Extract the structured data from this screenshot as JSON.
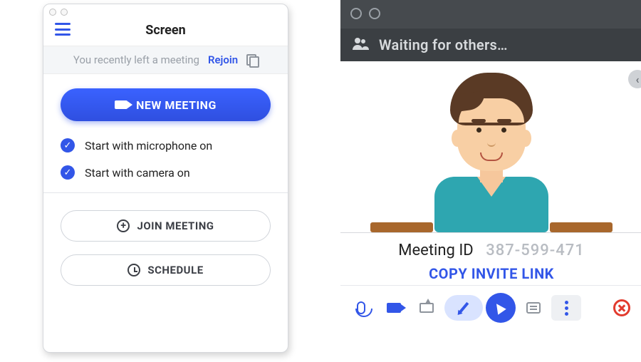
{
  "left": {
    "title": "Screen",
    "banner_text": "You recently left a meeting",
    "rejoin_label": "Rejoin",
    "new_meeting_label": "NEW MEETING",
    "opt_mic_label": "Start with microphone on",
    "opt_mic_checked": true,
    "opt_cam_label": "Start with camera on",
    "opt_cam_checked": true,
    "join_label": "JOIN MEETING",
    "schedule_label": "SCHEDULE"
  },
  "right": {
    "status_text": "Waiting for others…",
    "meeting_id_label": "Meeting ID",
    "meeting_id_value": "387-599-471",
    "copy_link_label": "COPY INVITE LINK"
  },
  "colors": {
    "primary": "#3256e8",
    "danger": "#e23b2e"
  }
}
